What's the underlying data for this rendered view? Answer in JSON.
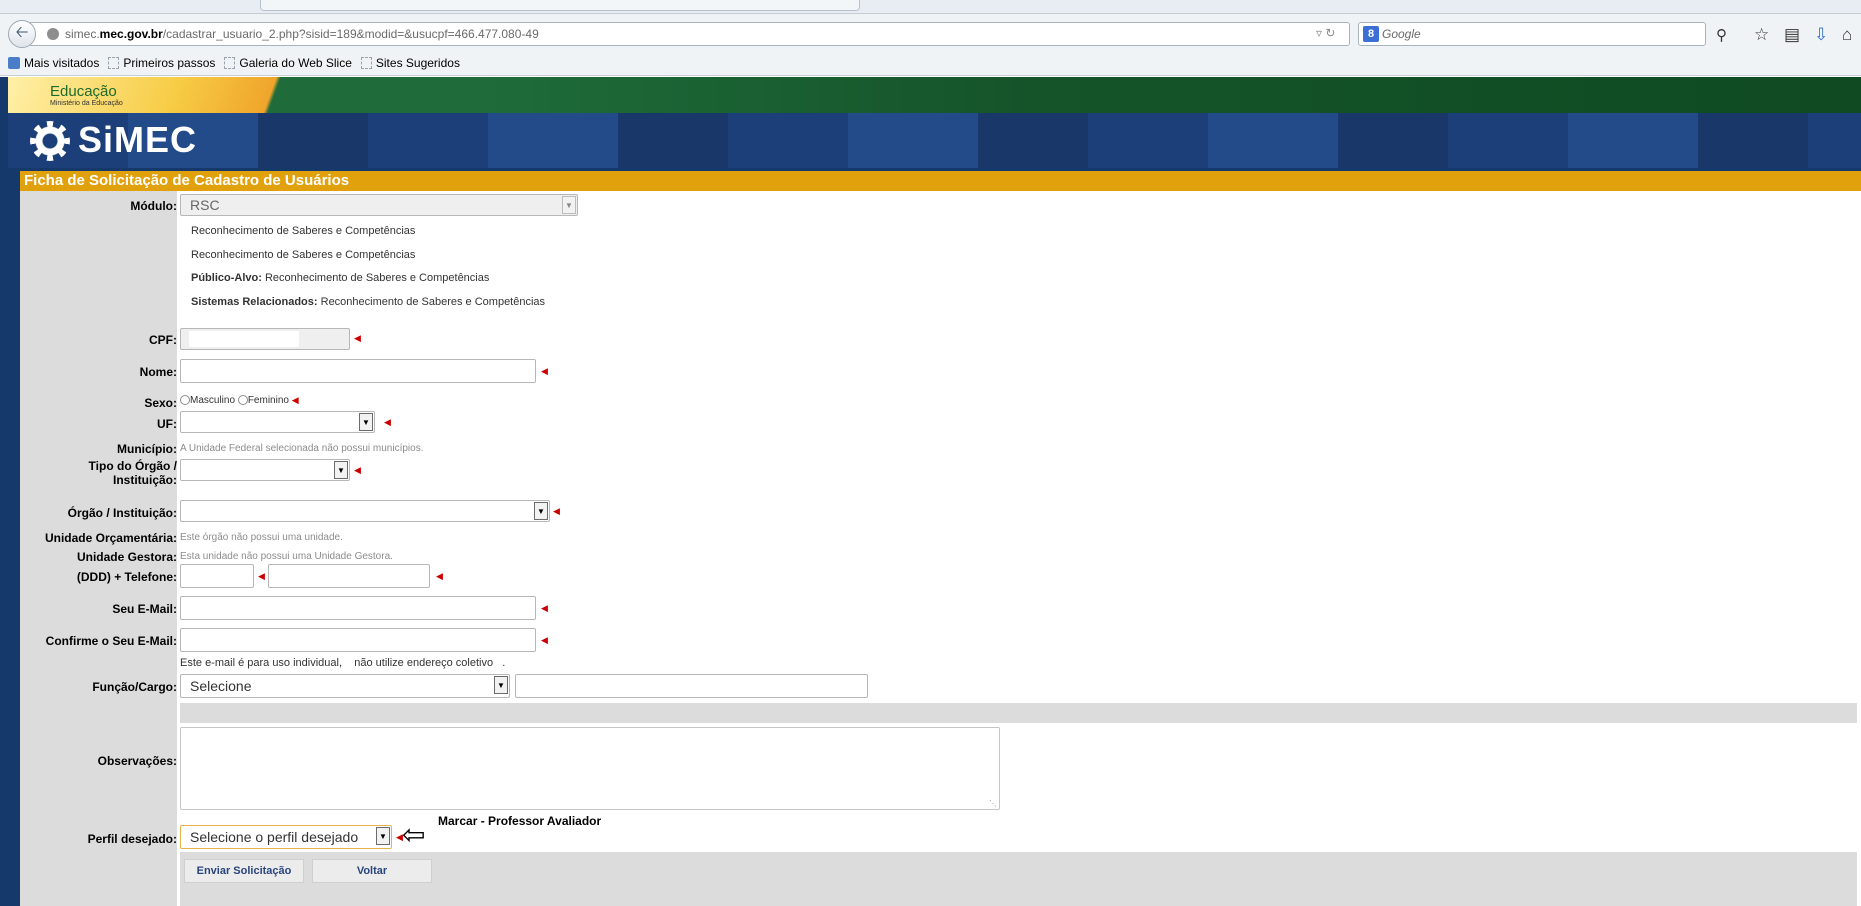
{
  "browser": {
    "url_prefix": "simec.",
    "url_domain": "mec.gov.br",
    "url_path": "/cadastrar_usuario_2.php?sisid=189&modid=&usucpf=466.477.080-49",
    "search_placeholder": "Google",
    "bookmarks": [
      "Mais visitados",
      "Primeiros passos",
      "Galeria do Web Slice",
      "Sites Sugeridos"
    ]
  },
  "header": {
    "gov_title": "Educação",
    "gov_subtitle": "Ministério da Educação",
    "logo": "SiMEC"
  },
  "form": {
    "title": "Ficha de Solicitação de Cadastro de Usuários",
    "modulo_label": "Módulo:",
    "modulo_value": "RSC",
    "modulo_desc1": "Reconhecimento de Saberes e Competências",
    "modulo_desc2": "Reconhecimento de Saberes e Competências",
    "publico_label": "Público-Alvo:",
    "publico_value": "Reconhecimento de Saberes e Competências",
    "sistemas_label": "Sistemas Relacionados:",
    "sistemas_value": "Reconhecimento de Saberes e Competências",
    "cpf_label": "CPF:",
    "nome_label": "Nome:",
    "sexo_label": "Sexo:",
    "sexo_masc": "Masculino",
    "sexo_fem": "Feminino",
    "uf_label": "UF:",
    "municipio_label": "Município:",
    "municipio_info": "A Unidade Federal selecionada não possui municípios.",
    "tipo_orgao_label_1": "Tipo do Órgão /",
    "tipo_orgao_label_2": "Instituição:",
    "orgao_label": "Órgão / Instituição:",
    "unidade_orc_label": "Unidade Orçamentária:",
    "unidade_orc_info": "Este órgão não possui uma unidade.",
    "unidade_gest_label": "Unidade Gestora:",
    "unidade_gest_info": "Esta unidade não possui uma Unidade Gestora.",
    "telefone_label": "(DDD) + Telefone:",
    "email_label": "Seu E-Mail:",
    "confirm_email_label": "Confirme o Seu E-Mail:",
    "email_note": "Este e-mail é para uso individual,    não utilize endereço coletivo   .",
    "funcao_label": "Função/Cargo:",
    "funcao_value": "Selecione",
    "observacoes_label": "Observações:",
    "perfil_label": "Perfil desejado:",
    "perfil_value": "Selecione o perfil desejado",
    "annotation": "Marcar - Professor Avaliador",
    "submit_button": "Enviar Solicitação",
    "back_button": "Voltar"
  }
}
